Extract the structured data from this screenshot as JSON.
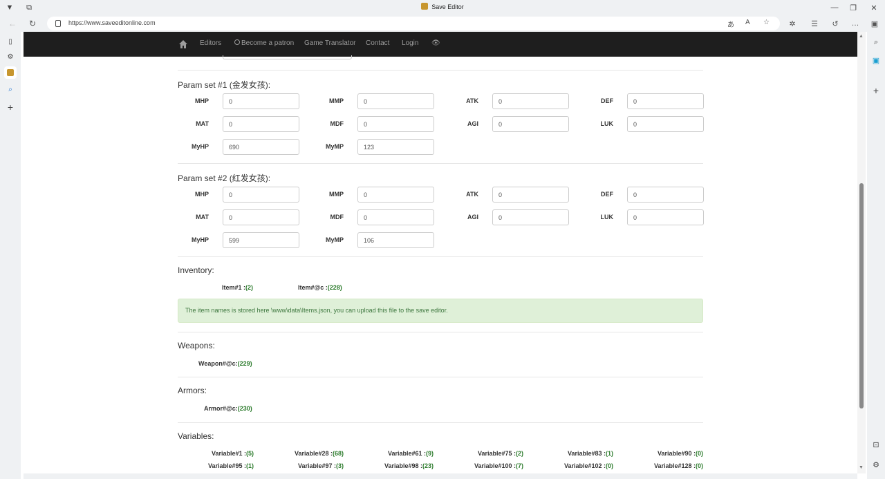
{
  "window": {
    "title": "Save Editor"
  },
  "browser": {
    "url": "https://www.saveeditonline.com"
  },
  "nav": {
    "items": [
      "Editors",
      "Become a patron",
      "Game Translator",
      "Contact",
      "Login"
    ]
  },
  "param_sets": [
    {
      "title": "Param set #1 (金发女孩):",
      "fields": [
        {
          "label": "MHP",
          "value": "0"
        },
        {
          "label": "MMP",
          "value": "0"
        },
        {
          "label": "ATK",
          "value": "0"
        },
        {
          "label": "DEF",
          "value": "0"
        },
        {
          "label": "MAT",
          "value": "0"
        },
        {
          "label": "MDF",
          "value": "0"
        },
        {
          "label": "AGI",
          "value": "0"
        },
        {
          "label": "LUK",
          "value": "0"
        },
        {
          "label": "MyHP",
          "value": "690"
        },
        {
          "label": "MyMP",
          "value": "123"
        }
      ]
    },
    {
      "title": "Param set #2 (红发女孩):",
      "fields": [
        {
          "label": "MHP",
          "value": "0"
        },
        {
          "label": "MMP",
          "value": "0"
        },
        {
          "label": "ATK",
          "value": "0"
        },
        {
          "label": "DEF",
          "value": "0"
        },
        {
          "label": "MAT",
          "value": "0"
        },
        {
          "label": "MDF",
          "value": "0"
        },
        {
          "label": "AGI",
          "value": "0"
        },
        {
          "label": "LUK",
          "value": "0"
        },
        {
          "label": "MyHP",
          "value": "599"
        },
        {
          "label": "MyMP",
          "value": "106"
        }
      ]
    }
  ],
  "inventory": {
    "title": "Inventory:",
    "items": [
      {
        "label": "Item#1 :",
        "value": "(2)"
      },
      {
        "label": "Item#@c :",
        "value": "(228)"
      }
    ],
    "notice": "The item names is stored here \\www\\data\\Items.json, you can upload this file to the save editor."
  },
  "weapons": {
    "title": "Weapons:",
    "items": [
      {
        "label": "Weapon#@c:",
        "value": "(229)"
      }
    ]
  },
  "armors": {
    "title": "Armors:",
    "items": [
      {
        "label": "Armor#@c:",
        "value": "(230)"
      }
    ]
  },
  "variables": {
    "title": "Variables:",
    "items": [
      {
        "label": "Variable#1 :",
        "value": "(5)"
      },
      {
        "label": "Variable#28 :",
        "value": "(68)"
      },
      {
        "label": "Variable#61 :",
        "value": "(9)"
      },
      {
        "label": "Variable#75 :",
        "value": "(2)"
      },
      {
        "label": "Variable#83 :",
        "value": "(1)"
      },
      {
        "label": "Variable#90 :",
        "value": "(0)"
      },
      {
        "label": "Variable#95 :",
        "value": "(1)"
      },
      {
        "label": "Variable#97 :",
        "value": "(3)"
      },
      {
        "label": "Variable#98 :",
        "value": "(23)"
      },
      {
        "label": "Variable#100 :",
        "value": "(7)"
      },
      {
        "label": "Variable#102 :",
        "value": "(0)"
      },
      {
        "label": "Variable#128 :",
        "value": "(0)"
      }
    ]
  },
  "colors": {
    "navbar": "#1e1e1e",
    "value_green": "#2a7a2a",
    "notice_bg": "#dff0d8"
  }
}
